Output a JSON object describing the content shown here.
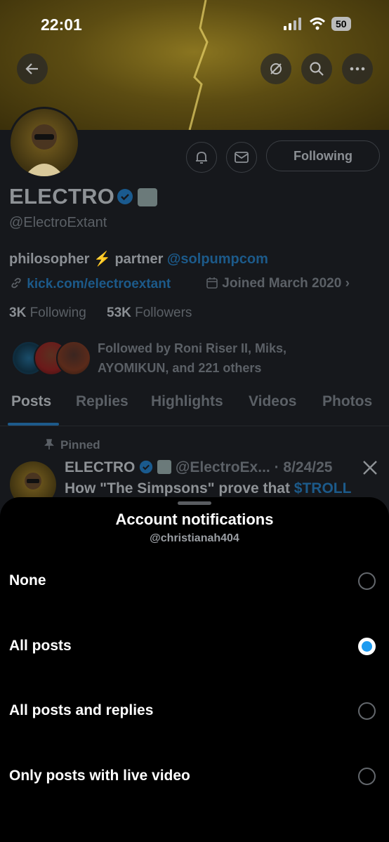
{
  "status_bar": {
    "time": "22:01",
    "battery": "50"
  },
  "profile": {
    "name": "ELECTRO",
    "handle": "@ElectroExtant",
    "bio_prefix": "philosopher ⚡ partner ",
    "bio_mention": "@solpumpcom",
    "link": "kick.com/electroextant",
    "joined": "Joined March 2020",
    "following_count": "3K",
    "following_label": " Following",
    "followers_count": "53K",
    "followers_label": " Followers",
    "followed_by": "Followed by Roni Riser II, Miks, AYOMIKUN, and 221 others",
    "following_button": "Following"
  },
  "tabs": [
    "Posts",
    "Replies",
    "Highlights",
    "Videos",
    "Photos"
  ],
  "pinned_post": {
    "pinned_label": "Pinned",
    "author": "ELECTRO",
    "handle_date": "@ElectroEx... · 8/24/25",
    "text_prefix": "How \"The Simpsons\" prove that ",
    "text_cashtag": "$TROLL"
  },
  "sheet": {
    "title": "Account notifications",
    "subtitle": "@christianah404",
    "options": [
      {
        "label": "None",
        "selected": false
      },
      {
        "label": "All posts",
        "selected": true
      },
      {
        "label": "All posts and replies",
        "selected": false
      },
      {
        "label": "Only posts with live video",
        "selected": false
      }
    ]
  },
  "colors": {
    "accent": "#1d9bf0",
    "sheet_bg": "#000000"
  }
}
